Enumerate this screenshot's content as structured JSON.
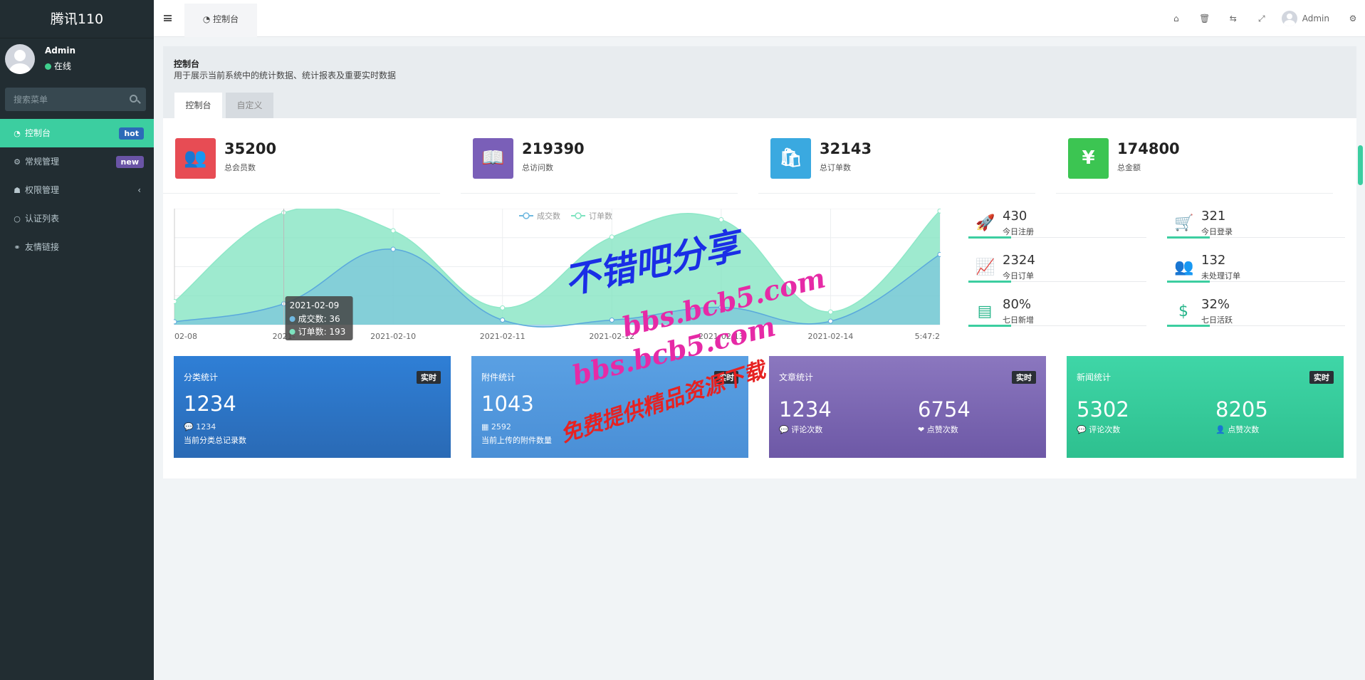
{
  "sidebar": {
    "logo": "腾讯110",
    "user": {
      "name": "Admin",
      "status": "在线"
    },
    "search_placeholder": "搜索菜单",
    "items": [
      {
        "label": "控制台",
        "icon": "dashboard-icon",
        "badge": "hot",
        "active": true
      },
      {
        "label": "常规管理",
        "icon": "cogs-icon",
        "badge": "new"
      },
      {
        "label": "权限管理",
        "icon": "users-icon",
        "chevron": "‹"
      },
      {
        "label": "认证列表",
        "icon": "circle-icon"
      },
      {
        "label": "友情链接",
        "icon": "link-icon"
      }
    ]
  },
  "topbar": {
    "tab_label": "控制台",
    "admin_name": "Admin"
  },
  "panel": {
    "title": "控制台",
    "description": "用于展示当前系统中的统计数据、统计报表及重要实时数据",
    "tabs": [
      "控制台",
      "自定义"
    ]
  },
  "stats": [
    {
      "value": "35200",
      "label": "总会员数",
      "color": "#e74c54",
      "icon": "users-icon",
      "glyph": "👥"
    },
    {
      "value": "219390",
      "label": "总访问数",
      "color": "#7a5fb8",
      "icon": "book-icon",
      "glyph": "📖"
    },
    {
      "value": "32143",
      "label": "总订单数",
      "color": "#3aa9e0",
      "icon": "shopping-bag-icon",
      "glyph": "🛍"
    },
    {
      "value": "174800",
      "label": "总金额",
      "color": "#3cc552",
      "icon": "yen-icon",
      "glyph": "¥"
    }
  ],
  "chart_data": {
    "type": "area",
    "x": [
      "2021-02-08",
      "2021-02-09",
      "2021-02-10",
      "2021-02-11",
      "2021-02-12",
      "2021-02-13",
      "2021-02-14",
      "5:47:2"
    ],
    "x_tick_labels": [
      "02-08",
      "2021-",
      "2021-02-10",
      "2021-02-11",
      "2021-02-12",
      "2021-02-13",
      "2021-02-14",
      "5:47:2"
    ],
    "series": [
      {
        "name": "成交数",
        "values": [
          5,
          36,
          130,
          8,
          8,
          30,
          6,
          121
        ],
        "color": "#6fb8e0"
      },
      {
        "name": "订单数",
        "values": [
          40,
          193,
          162,
          29,
          151,
          181,
          22,
          196
        ],
        "color": "#7de3bf"
      }
    ],
    "ylim": [
      0,
      200
    ],
    "grid": true,
    "legend_position": "top-center",
    "tooltip": {
      "title": "2021-02-09",
      "lines": [
        "成交数: 36",
        "订单数: 193"
      ]
    }
  },
  "mini_stats": [
    {
      "value": "430",
      "label": "今日注册",
      "icon": "rocket-icon",
      "glyph": "🚀"
    },
    {
      "value": "321",
      "label": "今日登录",
      "icon": "cart-icon",
      "glyph": "🛒"
    },
    {
      "value": "2324",
      "label": "今日订单",
      "icon": "line-chart-icon",
      "glyph": "📈"
    },
    {
      "value": "132",
      "label": "未处理订单",
      "icon": "users-icon",
      "glyph": "👥"
    },
    {
      "value": "80%",
      "label": "七日新增",
      "icon": "list-icon",
      "glyph": "▤"
    },
    {
      "value": "32%",
      "label": "七日活跃",
      "icon": "dollar-icon",
      "glyph": "$"
    }
  ],
  "cards": [
    {
      "title": "分类统计",
      "badge": "实时",
      "value": "1234",
      "sub": "💬 1234",
      "note": "当前分类总记录数",
      "color1": "#2f7fd6",
      "color2": "#2a6ab5"
    },
    {
      "title": "附件统计",
      "badge": "实时",
      "value": "1043",
      "sub": "▦ 2592",
      "note": "当前上传的附件数量",
      "color1": "#5aa0e3",
      "color2": "#4a8fd6"
    },
    {
      "title": "文章统计",
      "badge": "实时",
      "col1_value": "1234",
      "col1_label": "💬 评论次数",
      "col2_value": "6754",
      "col2_label": "❤ 点赞次数",
      "color1": "#8b77bf",
      "color2": "#6d58a6"
    },
    {
      "title": "新闻统计",
      "badge": "实时",
      "col1_value": "5302",
      "col1_label": "💬 评论次数",
      "col2_value": "8205",
      "col2_label": "👤 点赞次数",
      "color1": "#3fd6a7",
      "color2": "#2ec08f"
    }
  ],
  "watermark": {
    "line1": "不错吧分享",
    "line2": "bbs.bcb5.com",
    "line3": "bbs.bcb5.com",
    "line4": "免费提供精品资源下载"
  }
}
